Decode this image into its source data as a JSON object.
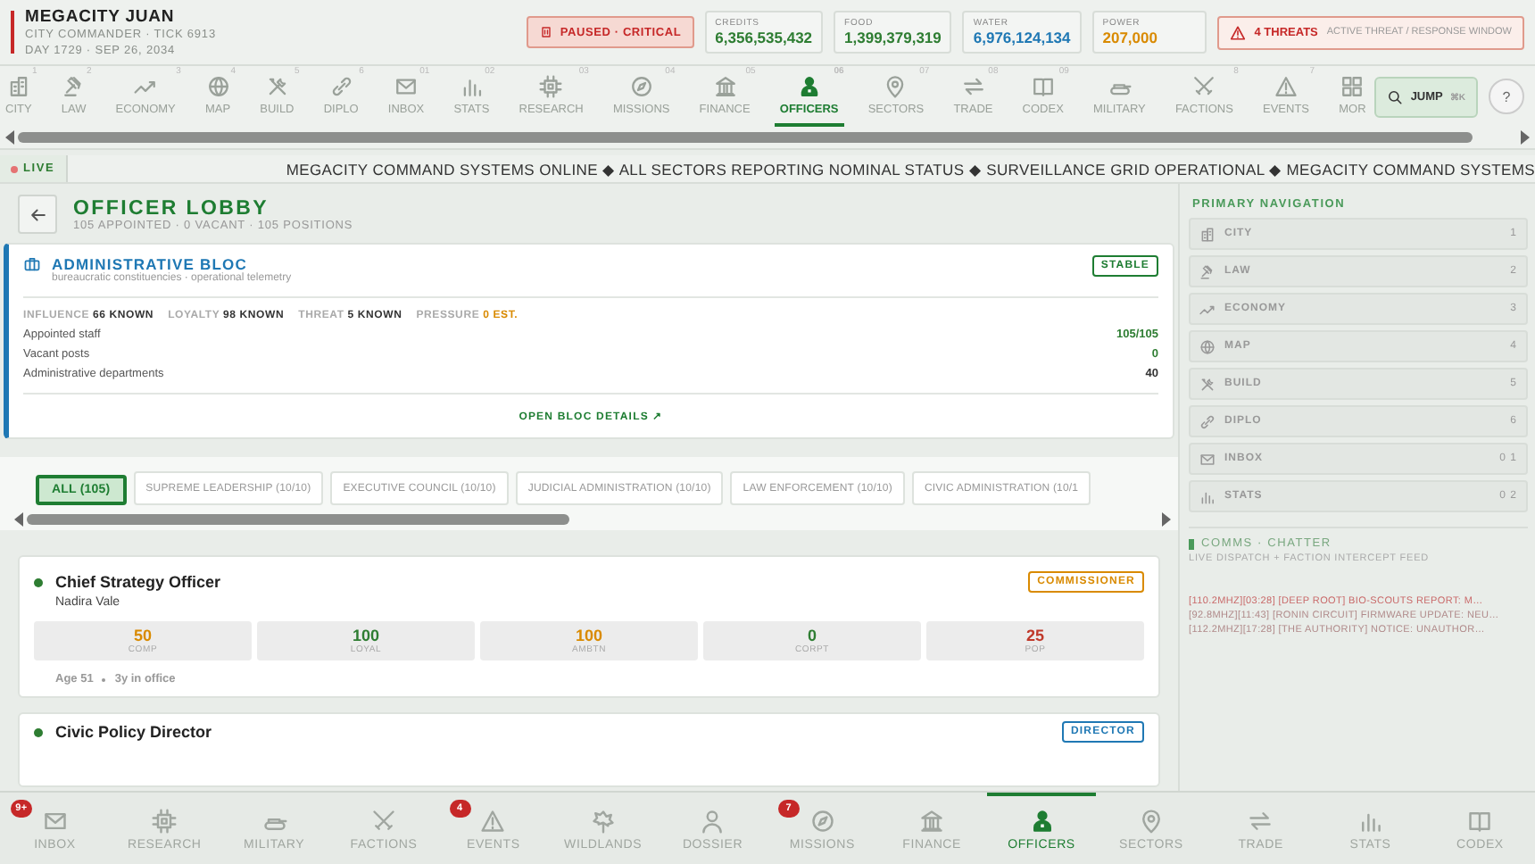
{
  "header": {
    "title": "MEGACITY JUAN",
    "subtitle": "CITY COMMANDER · TICK 6913",
    "date": "DAY 1729 · SEP 26, 2034",
    "status": "PAUSED · CRITICAL",
    "resources": [
      {
        "label": "CREDITS",
        "value": "6,356,535,432",
        "color": "#2e7d32"
      },
      {
        "label": "FOOD",
        "value": "1,399,379,319",
        "color": "#2e7d32"
      },
      {
        "label": "WATER",
        "value": "6,976,124,134",
        "color": "#1f78b4"
      },
      {
        "label": "POWER",
        "value": "207,000",
        "color": "#d98a00"
      }
    ],
    "threats": {
      "count": "4 THREATS",
      "note": "ACTIVE THREAT / RESPONSE WINDOW"
    }
  },
  "top_nav": {
    "tabs": [
      {
        "label": "CITY",
        "shortcut": "1",
        "selected": false
      },
      {
        "label": "LAW",
        "shortcut": "2",
        "selected": false
      },
      {
        "label": "ECONOMY",
        "shortcut": "3",
        "selected": false
      },
      {
        "label": "MAP",
        "shortcut": "4",
        "selected": false
      },
      {
        "label": "BUILD",
        "shortcut": "5",
        "selected": false
      },
      {
        "label": "DIPLO",
        "shortcut": "6",
        "selected": false
      },
      {
        "label": "INBOX",
        "shortcut": "01",
        "selected": false
      },
      {
        "label": "STATS",
        "shortcut": "02",
        "selected": false
      },
      {
        "label": "RESEARCH",
        "shortcut": "03",
        "selected": false
      },
      {
        "label": "MISSIONS",
        "shortcut": "04",
        "selected": false
      },
      {
        "label": "FINANCE",
        "shortcut": "05",
        "selected": false
      },
      {
        "label": "OFFICERS",
        "shortcut": "06",
        "selected": true
      },
      {
        "label": "SECTORS",
        "shortcut": "07",
        "selected": false
      },
      {
        "label": "TRADE",
        "shortcut": "08",
        "selected": false
      },
      {
        "label": "CODEX",
        "shortcut": "09",
        "selected": false
      },
      {
        "label": "MILITARY",
        "selected": false
      },
      {
        "label": "FACTIONS",
        "shortcut": "8",
        "selected": false
      },
      {
        "label": "EVENTS",
        "shortcut": "7",
        "selected": false
      },
      {
        "label": "MOR",
        "selected": false
      }
    ],
    "jump": {
      "label": "JUMP",
      "shortcut": "⌘K"
    },
    "help": "?"
  },
  "ticker": {
    "live": "LIVE",
    "text": "MEGACITY COMMAND SYSTEMS ONLINE ◆ ALL SECTORS REPORTING NOMINAL STATUS ◆ SURVEILLANCE GRID OPERATIONAL ◆ MEGACITY COMMAND SYSTEMS"
  },
  "lobby": {
    "title": "OFFICER LOBBY",
    "subtitle": "105 APPOINTED · 0 VACANT · 105 POSITIONS"
  },
  "bloc": {
    "title": "ADMINISTRATIVE BLOC",
    "subtitle": "bureaucratic constituencies · operational telemetry",
    "status": "STABLE",
    "metrics": [
      {
        "label": "INFLUENCE",
        "value": "66 KNOWN",
        "color": "#333333"
      },
      {
        "label": "LOYALTY",
        "value": "98 KNOWN",
        "color": "#333333"
      },
      {
        "label": "THREAT",
        "value": "5 KNOWN",
        "color": "#333333"
      },
      {
        "label": "PRESSURE",
        "value": "0 EST.",
        "color": "#d98a00"
      }
    ],
    "rows": [
      {
        "label": "Appointed staff",
        "value": "105/105",
        "color": "#2e7d32"
      },
      {
        "label": "Vacant posts",
        "value": "0",
        "color": "#2e7d32"
      },
      {
        "label": "Administrative departments",
        "value": "40",
        "color": "#333333"
      }
    ],
    "link": "OPEN BLOC DETAILS ↗"
  },
  "filters": [
    {
      "label": "ALL (105)",
      "selected": true
    },
    {
      "label": "SUPREME LEADERSHIP (10/10)",
      "selected": false
    },
    {
      "label": "EXECUTIVE COUNCIL (10/10)",
      "selected": false
    },
    {
      "label": "JUDICIAL ADMINISTRATION (10/10)",
      "selected": false
    },
    {
      "label": "LAW ENFORCEMENT (10/10)",
      "selected": false
    },
    {
      "label": "CIVIC ADMINISTRATION (10/1",
      "selected": false
    }
  ],
  "officers": [
    {
      "title": "Chief Strategy Officer",
      "name": "Nadira Vale",
      "color": "#2e7d32",
      "rank": {
        "label": "COMMISSIONER",
        "color": "#d98a00"
      },
      "stats": [
        {
          "value": "50",
          "label": "COMP",
          "color": "#d98a00"
        },
        {
          "value": "100",
          "label": "LOYAL",
          "color": "#2e7d32"
        },
        {
          "value": "100",
          "label": "AMBTN",
          "color": "#d98a00"
        },
        {
          "value": "0",
          "label": "CORPT",
          "color": "#2e7d32"
        },
        {
          "value": "25",
          "label": "POP",
          "color": "#c0392b"
        }
      ],
      "age": "Age 51",
      "tenure": "3y in office"
    },
    {
      "title": "Civic Policy Director",
      "color": "#2e7d32",
      "rank": {
        "label": "DIRECTOR",
        "color": "#1f78b4"
      }
    }
  ],
  "sidebar": {
    "title": "PRIMARY NAVIGATION",
    "items": [
      {
        "label": "CITY",
        "shortcut": "1"
      },
      {
        "label": "LAW",
        "shortcut": "2"
      },
      {
        "label": "ECONOMY",
        "shortcut": "3"
      },
      {
        "label": "MAP",
        "shortcut": "4"
      },
      {
        "label": "BUILD",
        "shortcut": "5"
      },
      {
        "label": "DIPLO",
        "shortcut": "6"
      },
      {
        "label": "INBOX",
        "shortcut": "0 1"
      },
      {
        "label": "STATS",
        "shortcut": "0 2"
      }
    ],
    "comms": {
      "title": "COMMS · CHATTER",
      "subtitle": "LIVE DISPATCH + FACTION INTERCEPT FEED",
      "messages": [
        {
          "text": "[110.2MHZ][03:28] [DEEP ROOT] BIO-SCOUTS REPORT: M…",
          "color": "#c96a6a"
        },
        {
          "text": "[92.8MHZ][11:43] [RONIN CIRCUIT] FIRMWARE UPDATE: NEU…",
          "color": "#b08a8a"
        },
        {
          "text": "[112.2MHZ][17:28] [THE AUTHORITY] NOTICE: UNAUTHOR…",
          "color": "#b08a8a"
        }
      ]
    }
  },
  "bottom_nav": [
    {
      "label": "INBOX",
      "badge": "9+",
      "selected": false
    },
    {
      "label": "RESEARCH",
      "selected": false
    },
    {
      "label": "MILITARY",
      "selected": false
    },
    {
      "label": "FACTIONS",
      "selected": false
    },
    {
      "label": "EVENTS",
      "badge": "4",
      "selected": false
    },
    {
      "label": "WILDLANDS",
      "selected": false
    },
    {
      "label": "DOSSIER",
      "selected": false
    },
    {
      "label": "MISSIONS",
      "badge": "7",
      "selected": false
    },
    {
      "label": "FINANCE",
      "selected": false
    },
    {
      "label": "OFFICERS",
      "selected": true
    },
    {
      "label": "SECTORS",
      "selected": false
    },
    {
      "label": "TRADE",
      "selected": false
    },
    {
      "label": "STATS",
      "selected": false
    },
    {
      "label": "CODEX",
      "selected": false
    }
  ]
}
